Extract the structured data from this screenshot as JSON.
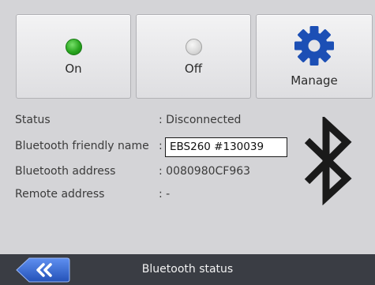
{
  "buttons": {
    "on_label": "On",
    "off_label": "Off",
    "manage_label": "Manage"
  },
  "info": {
    "status_label": "Status",
    "status_value": ": Disconnected",
    "friendly_name_label": "Bluetooth friendly name",
    "friendly_name_colon": ":",
    "friendly_name_value": "EBS260 #130039",
    "address_label": "Bluetooth address",
    "address_value": ": 0080980CF963",
    "remote_label": "Remote address",
    "remote_value": ": -"
  },
  "footer": {
    "title": "Bluetooth status"
  },
  "icons": {
    "led_on": "green-led-icon",
    "led_off": "grey-led-icon",
    "manage": "gear-icon",
    "bluetooth": "bluetooth-icon",
    "back": "double-chevron-left-icon"
  },
  "colors": {
    "accent_blue": "#1c4fb5",
    "led_green": "#2aa620",
    "bar_background": "#3a3d44",
    "screen_background": "#d4d4d7"
  }
}
